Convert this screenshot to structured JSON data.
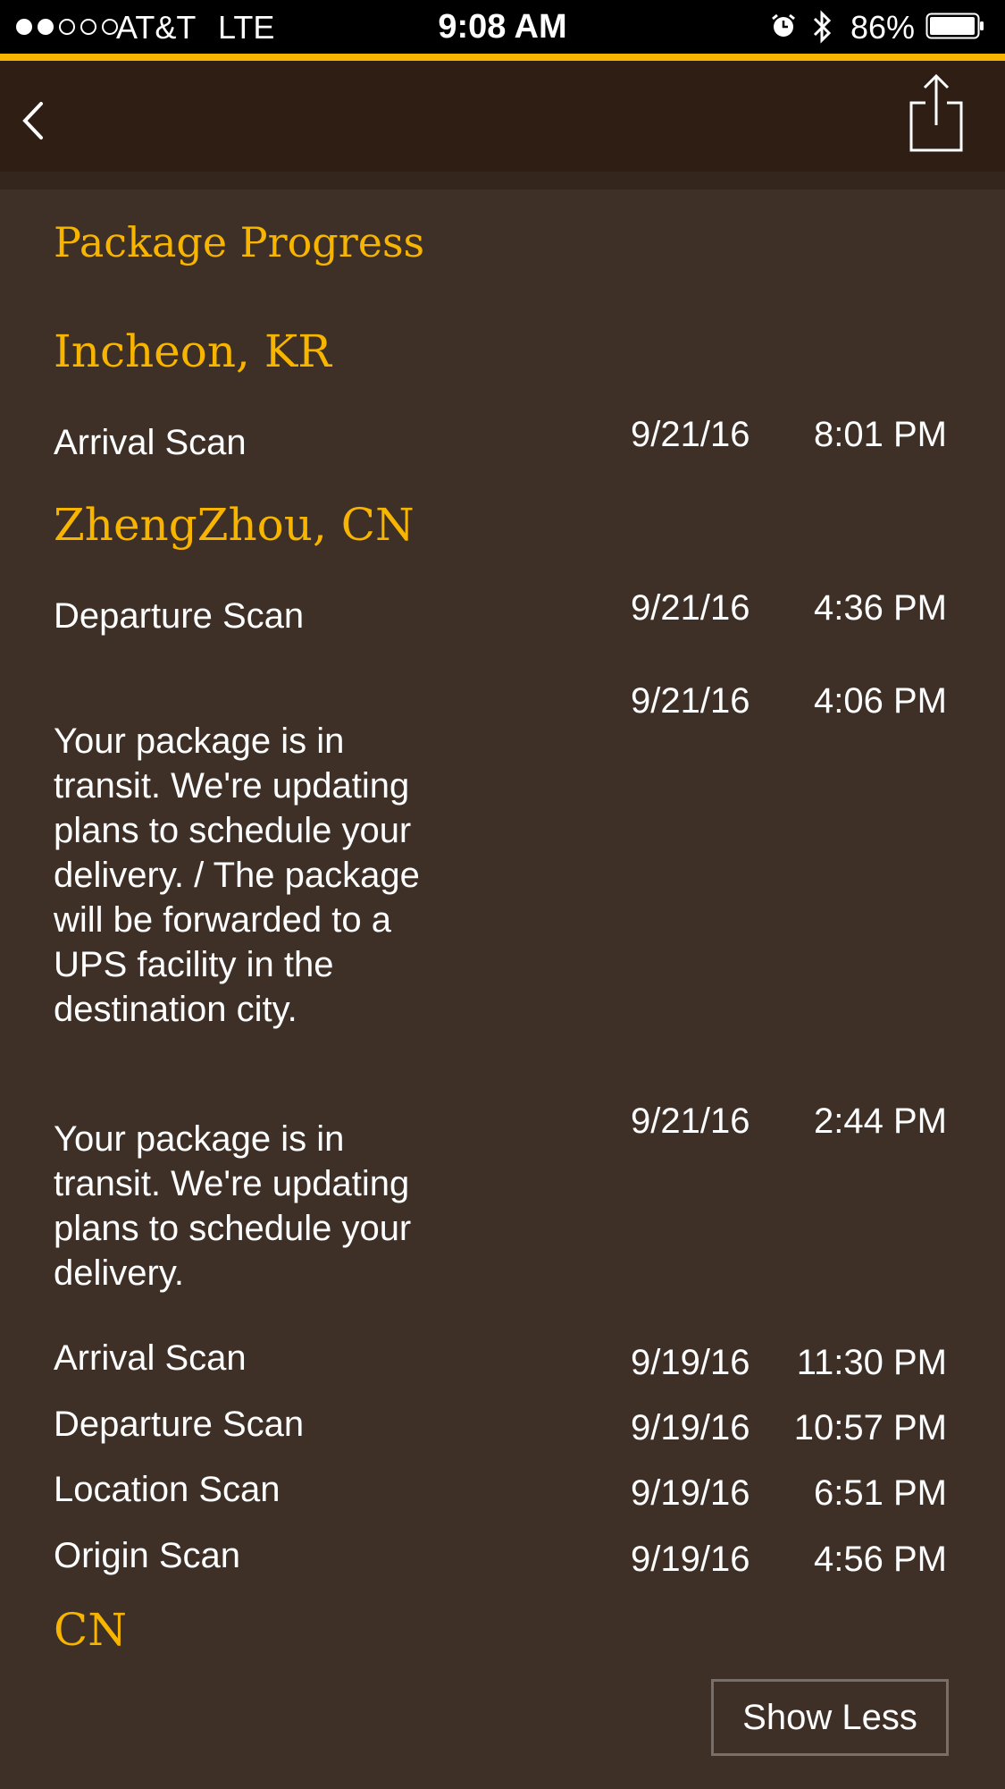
{
  "status_bar": {
    "carrier": "AT&T",
    "network": "LTE",
    "time": "9:08 AM",
    "battery_percent": "86%",
    "signal_bars_filled": 2,
    "signal_bars_total": 5
  },
  "nav": {
    "back_icon": "chevron-left-icon",
    "share_icon": "share-icon"
  },
  "section_title": "Package Progress",
  "locations": [
    {
      "name": "Incheon, KR",
      "events": [
        {
          "activity": "Arrival Scan",
          "date": "9/21/16",
          "time": "8:01 PM"
        }
      ]
    },
    {
      "name": "ZhengZhou, CN",
      "events": [
        {
          "activity": "Departure Scan",
          "date": "9/21/16",
          "time": "4:36 PM"
        },
        {
          "activity": "Your package is in transit. We're updating plans to schedule your delivery.  / The package will be forwarded to a UPS facility in the destination city.",
          "date": "9/21/16",
          "time": "4:06 PM"
        },
        {
          "activity": "Your package is in transit. We're updating plans to schedule your delivery.",
          "date": "9/21/16",
          "time": "2:44 PM"
        },
        {
          "activity": "Arrival Scan",
          "date": "9/19/16",
          "time": "11:30 PM"
        },
        {
          "activity": "Departure Scan",
          "date": "9/19/16",
          "time": "10:57 PM"
        },
        {
          "activity": "Location Scan",
          "date": "9/19/16",
          "time": "6:51 PM"
        },
        {
          "activity": "Origin Scan",
          "date": "9/19/16",
          "time": "4:56 PM"
        }
      ]
    },
    {
      "name": "CN",
      "events": []
    }
  ],
  "show_less_label": "Show Less",
  "colors": {
    "accent": "#f7b500",
    "background": "#3f3027",
    "navbar": "#2e1e14",
    "text": "#ffffff"
  }
}
